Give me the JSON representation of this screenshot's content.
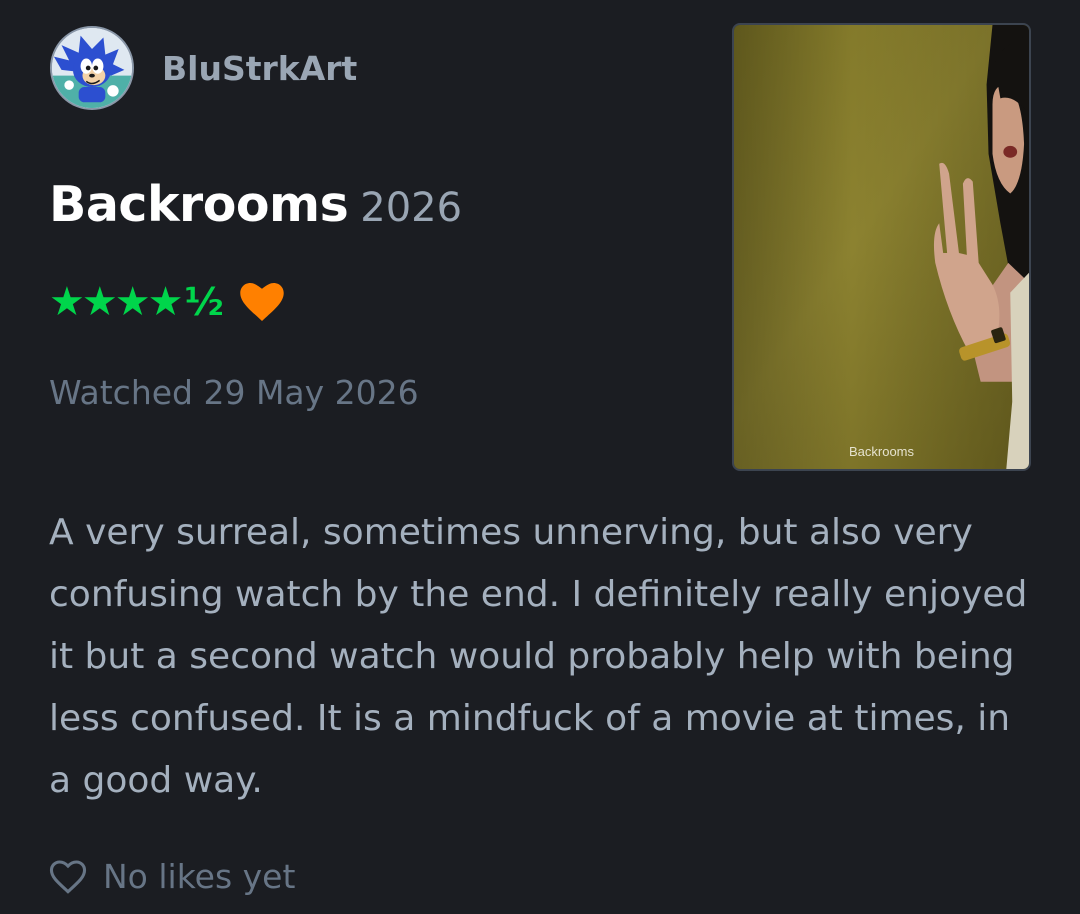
{
  "reviewer": {
    "username": "BluStrkArt",
    "avatar_icon": "sonic-avatar"
  },
  "film": {
    "title": "Backrooms",
    "year": "2026",
    "poster_label": "Backrooms"
  },
  "rating": {
    "stars": "★★★★",
    "half": "½",
    "value": 4.5,
    "max": 5,
    "liked": true,
    "star_color": "#00d54b",
    "heart_color": "#ff8000"
  },
  "watched": {
    "text": "Watched 29 May 2026"
  },
  "review": {
    "text": "A very surreal, sometimes unnerving, but also very confusing watch by the end. I definitely really enjoyed it but a second watch would probably help with being less confused. It is a mindfuck of a movie at times, in a good way."
  },
  "likes": {
    "text": "No likes yet",
    "icon": "heart-outline-icon"
  },
  "colors": {
    "background": "#1b1d22",
    "username": "#9aa6b4",
    "title": "#ffffff",
    "muted": "#677586",
    "body": "#a4b0be"
  }
}
